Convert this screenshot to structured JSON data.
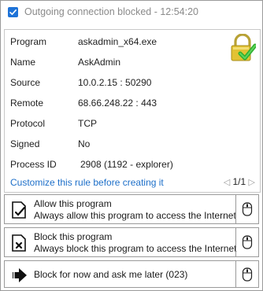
{
  "window": {
    "title": "Outgoing connection blocked - 12:54:20",
    "checkbox_checked": true
  },
  "info": {
    "rows": [
      {
        "label": "Program",
        "value": "askadmin_x64.exe"
      },
      {
        "label": "Name",
        "value": "AskAdmin"
      },
      {
        "label": "Source",
        "value": "10.0.2.15 : 50290"
      },
      {
        "label": "Remote",
        "value": "68.66.248.22 : 443"
      },
      {
        "label": "Protocol",
        "value": "TCP"
      },
      {
        "label": "Signed",
        "value": "No"
      },
      {
        "label": "Process ID",
        "value": "2908 (1192 - explorer)"
      }
    ],
    "customize_link": "Customize this rule before creating it",
    "pager": "1/1",
    "link_color": "#1d6fc9"
  },
  "actions": [
    {
      "title": "Allow this program",
      "subtitle": "Always allow this program to access the Internet",
      "icon": "allow-document-icon"
    },
    {
      "title": "Block this program",
      "subtitle": "Always block this program to access the Internet",
      "icon": "block-document-icon"
    },
    {
      "title": "Block for now and ask me later (023)",
      "icon": "arrow-right-icon"
    }
  ]
}
